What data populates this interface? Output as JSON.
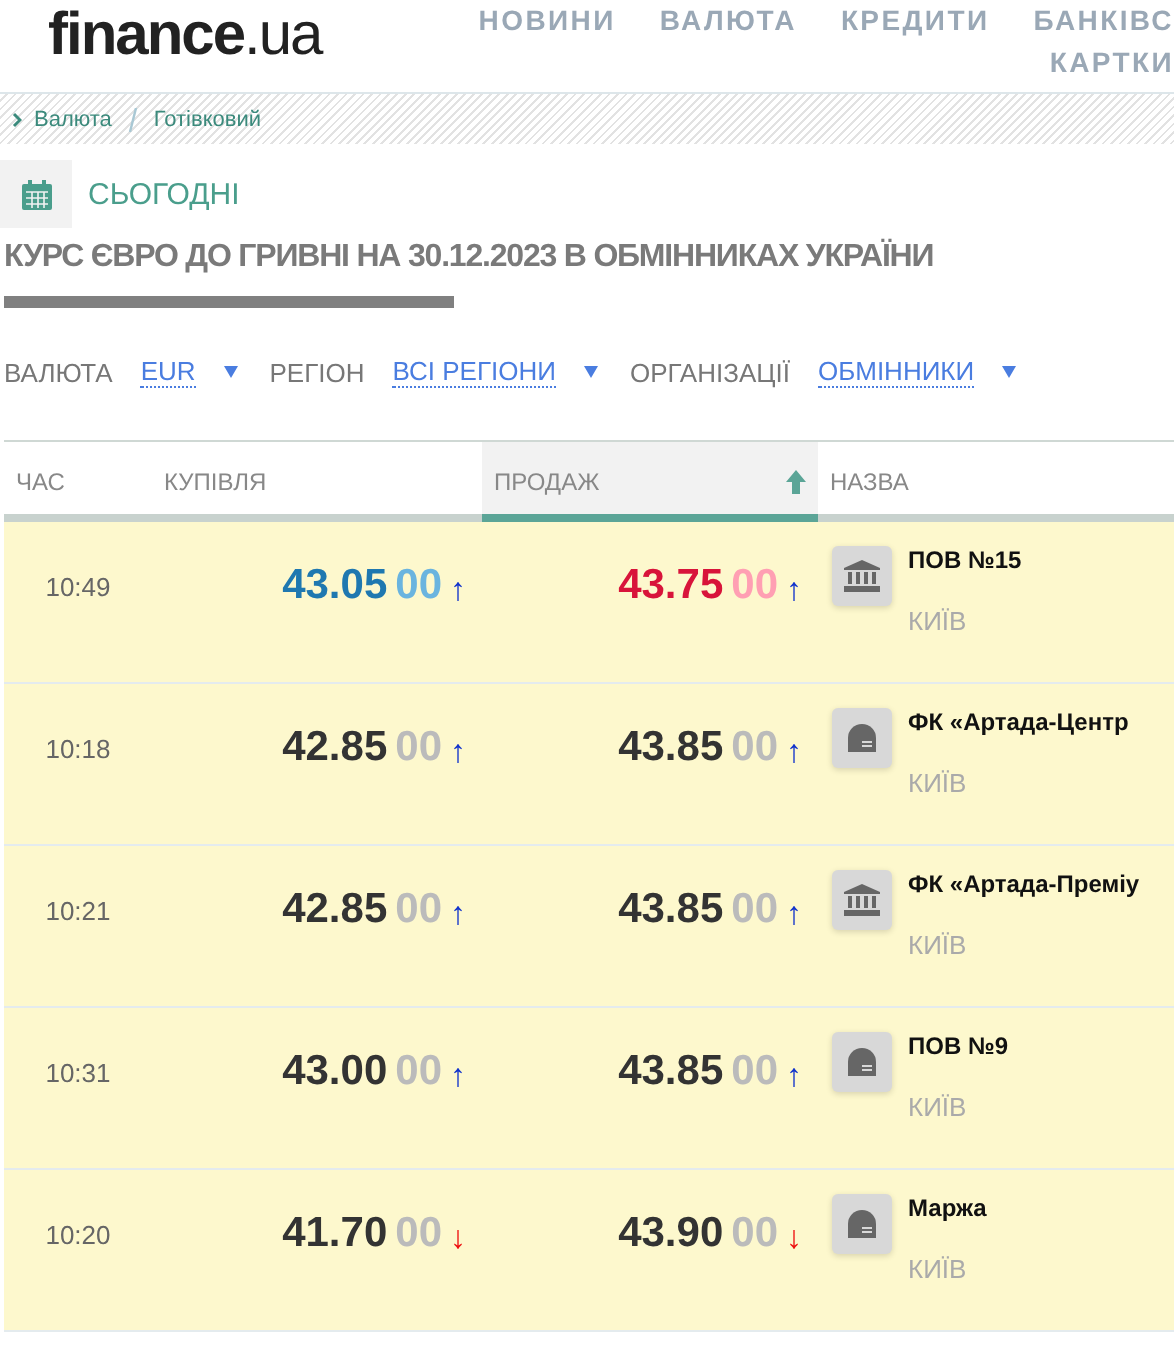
{
  "header": {
    "logo": {
      "main": "finance",
      "suffix": ".ua"
    },
    "nav": [
      "НОВИНИ",
      "ВАЛЮТА",
      "КРЕДИТИ",
      "БАНКІВС"
    ],
    "nav_second_line": "КАРТКИ"
  },
  "breadcrumbs": [
    "Валюта",
    "Готівковий"
  ],
  "today": "СЬОГОДНІ",
  "title": "КУРС ЄВРО ДО ГРИВНІ НА 30.12.2023 В ОБМІННИКАХ УКРАЇНИ",
  "filters": [
    {
      "label": "ВАЛЮТА",
      "value": "EUR"
    },
    {
      "label": "РЕГІОН",
      "value": "ВСІ РЕГІОНИ"
    },
    {
      "label": "ОРГАНІЗАЦІЇ",
      "value": "ОБМІННИКИ"
    }
  ],
  "table": {
    "columns": [
      {
        "label": "ЧАС",
        "selected": false
      },
      {
        "label": "КУПІВЛЯ",
        "selected": false
      },
      {
        "label": "ПРОДАЖ",
        "selected": true
      },
      {
        "label": "НАЗВА",
        "selected": false
      }
    ],
    "rows": [
      {
        "time": "10:49",
        "buy": "43.05",
        "buy_frac": "00",
        "buy_arrow": {
          "text": "↑",
          "color": "#1133cc"
        },
        "buy_best": true,
        "sell": "43.75",
        "sell_frac": "00",
        "sell_arrow": {
          "text": "↑",
          "color": "#1133cc"
        },
        "sell_best": true,
        "kind": "bank",
        "name": "ПОВ №15",
        "city": "КИЇВ"
      },
      {
        "time": "10:18",
        "buy": "42.85",
        "buy_frac": "00",
        "buy_arrow": {
          "text": "↑",
          "color": "#1133cc"
        },
        "buy_best": false,
        "sell": "43.85",
        "sell_frac": "00",
        "sell_arrow": {
          "text": "↑",
          "color": "#1133cc"
        },
        "sell_best": false,
        "kind": "exchange",
        "name": "ФК «Артада-Центр",
        "city": "КИЇВ"
      },
      {
        "time": "10:21",
        "buy": "42.85",
        "buy_frac": "00",
        "buy_arrow": {
          "text": "↑",
          "color": "#1133cc"
        },
        "buy_best": false,
        "sell": "43.85",
        "sell_frac": "00",
        "sell_arrow": {
          "text": "↑",
          "color": "#1133cc"
        },
        "sell_best": false,
        "kind": "bank",
        "name": "ФК «Артада-Преміу",
        "city": "КИЇВ"
      },
      {
        "time": "10:31",
        "buy": "43.00",
        "buy_frac": "00",
        "buy_arrow": {
          "text": "↑",
          "color": "#1133cc"
        },
        "buy_best": false,
        "sell": "43.85",
        "sell_frac": "00",
        "sell_arrow": {
          "text": "↑",
          "color": "#1133cc"
        },
        "sell_best": false,
        "kind": "exchange",
        "name": "ПОВ №9",
        "city": "КИЇВ"
      },
      {
        "time": "10:20",
        "buy": "41.70",
        "buy_frac": "00",
        "buy_arrow": {
          "text": "↓",
          "color": "#ee1111"
        },
        "buy_best": false,
        "sell": "43.90",
        "sell_frac": "00",
        "sell_arrow": {
          "text": "↓",
          "color": "#ee1111"
        },
        "sell_best": false,
        "kind": "exchange",
        "name": "Маржа",
        "city": "КИЇВ"
      }
    ]
  }
}
